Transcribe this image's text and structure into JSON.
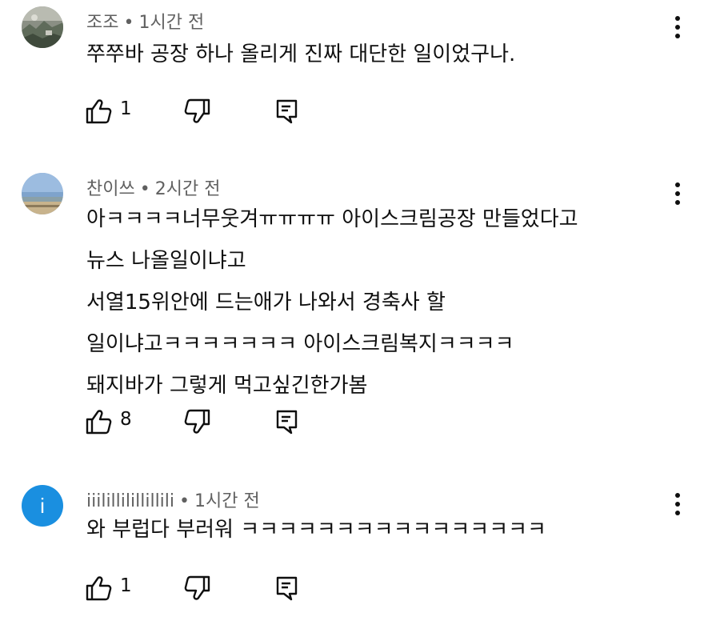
{
  "comments": [
    {
      "author": "조조",
      "time": "1시간 전",
      "text_lines": [
        "쭈쭈바 공장 하나 올리게 진짜 대단한 일이었구나."
      ],
      "likes": "1",
      "avatar": "photo-thumbnail"
    },
    {
      "author": "찬이쓰",
      "time": "2시간 전",
      "text_lines": [
        "아ㅋㅋㅋㅋ너무웃겨ㅠㅠㅠㅠ 아이스크림공장 만들었다고",
        "뉴스 나올일이냐고",
        "서열15위안에 드는애가 나와서 경축사 할",
        "일이냐고ㅋㅋㅋㅋㅋㅋㅋ 아이스크림복지ㅋㅋㅋㅋ",
        "돼지바가 그렇게 먹고싶긴한가봄"
      ],
      "likes": "8",
      "avatar": "landscape-thumbnail"
    },
    {
      "author": "iiilillilillillili",
      "time": "1시간 전",
      "text_lines": [
        "와 부럽다 부러워 ㅋㅋㅋㅋㅋㅋㅋㅋㅋㅋㅋㅋㅋㅋㅋㅋ"
      ],
      "likes": "1",
      "avatar_letter": "i",
      "avatar_color": "#1a8fe0"
    }
  ],
  "icons": {
    "like": "thumbs-up-icon",
    "dislike": "thumbs-down-icon",
    "reply": "reply-icon",
    "more": "more-vert-icon"
  },
  "separator": "•"
}
